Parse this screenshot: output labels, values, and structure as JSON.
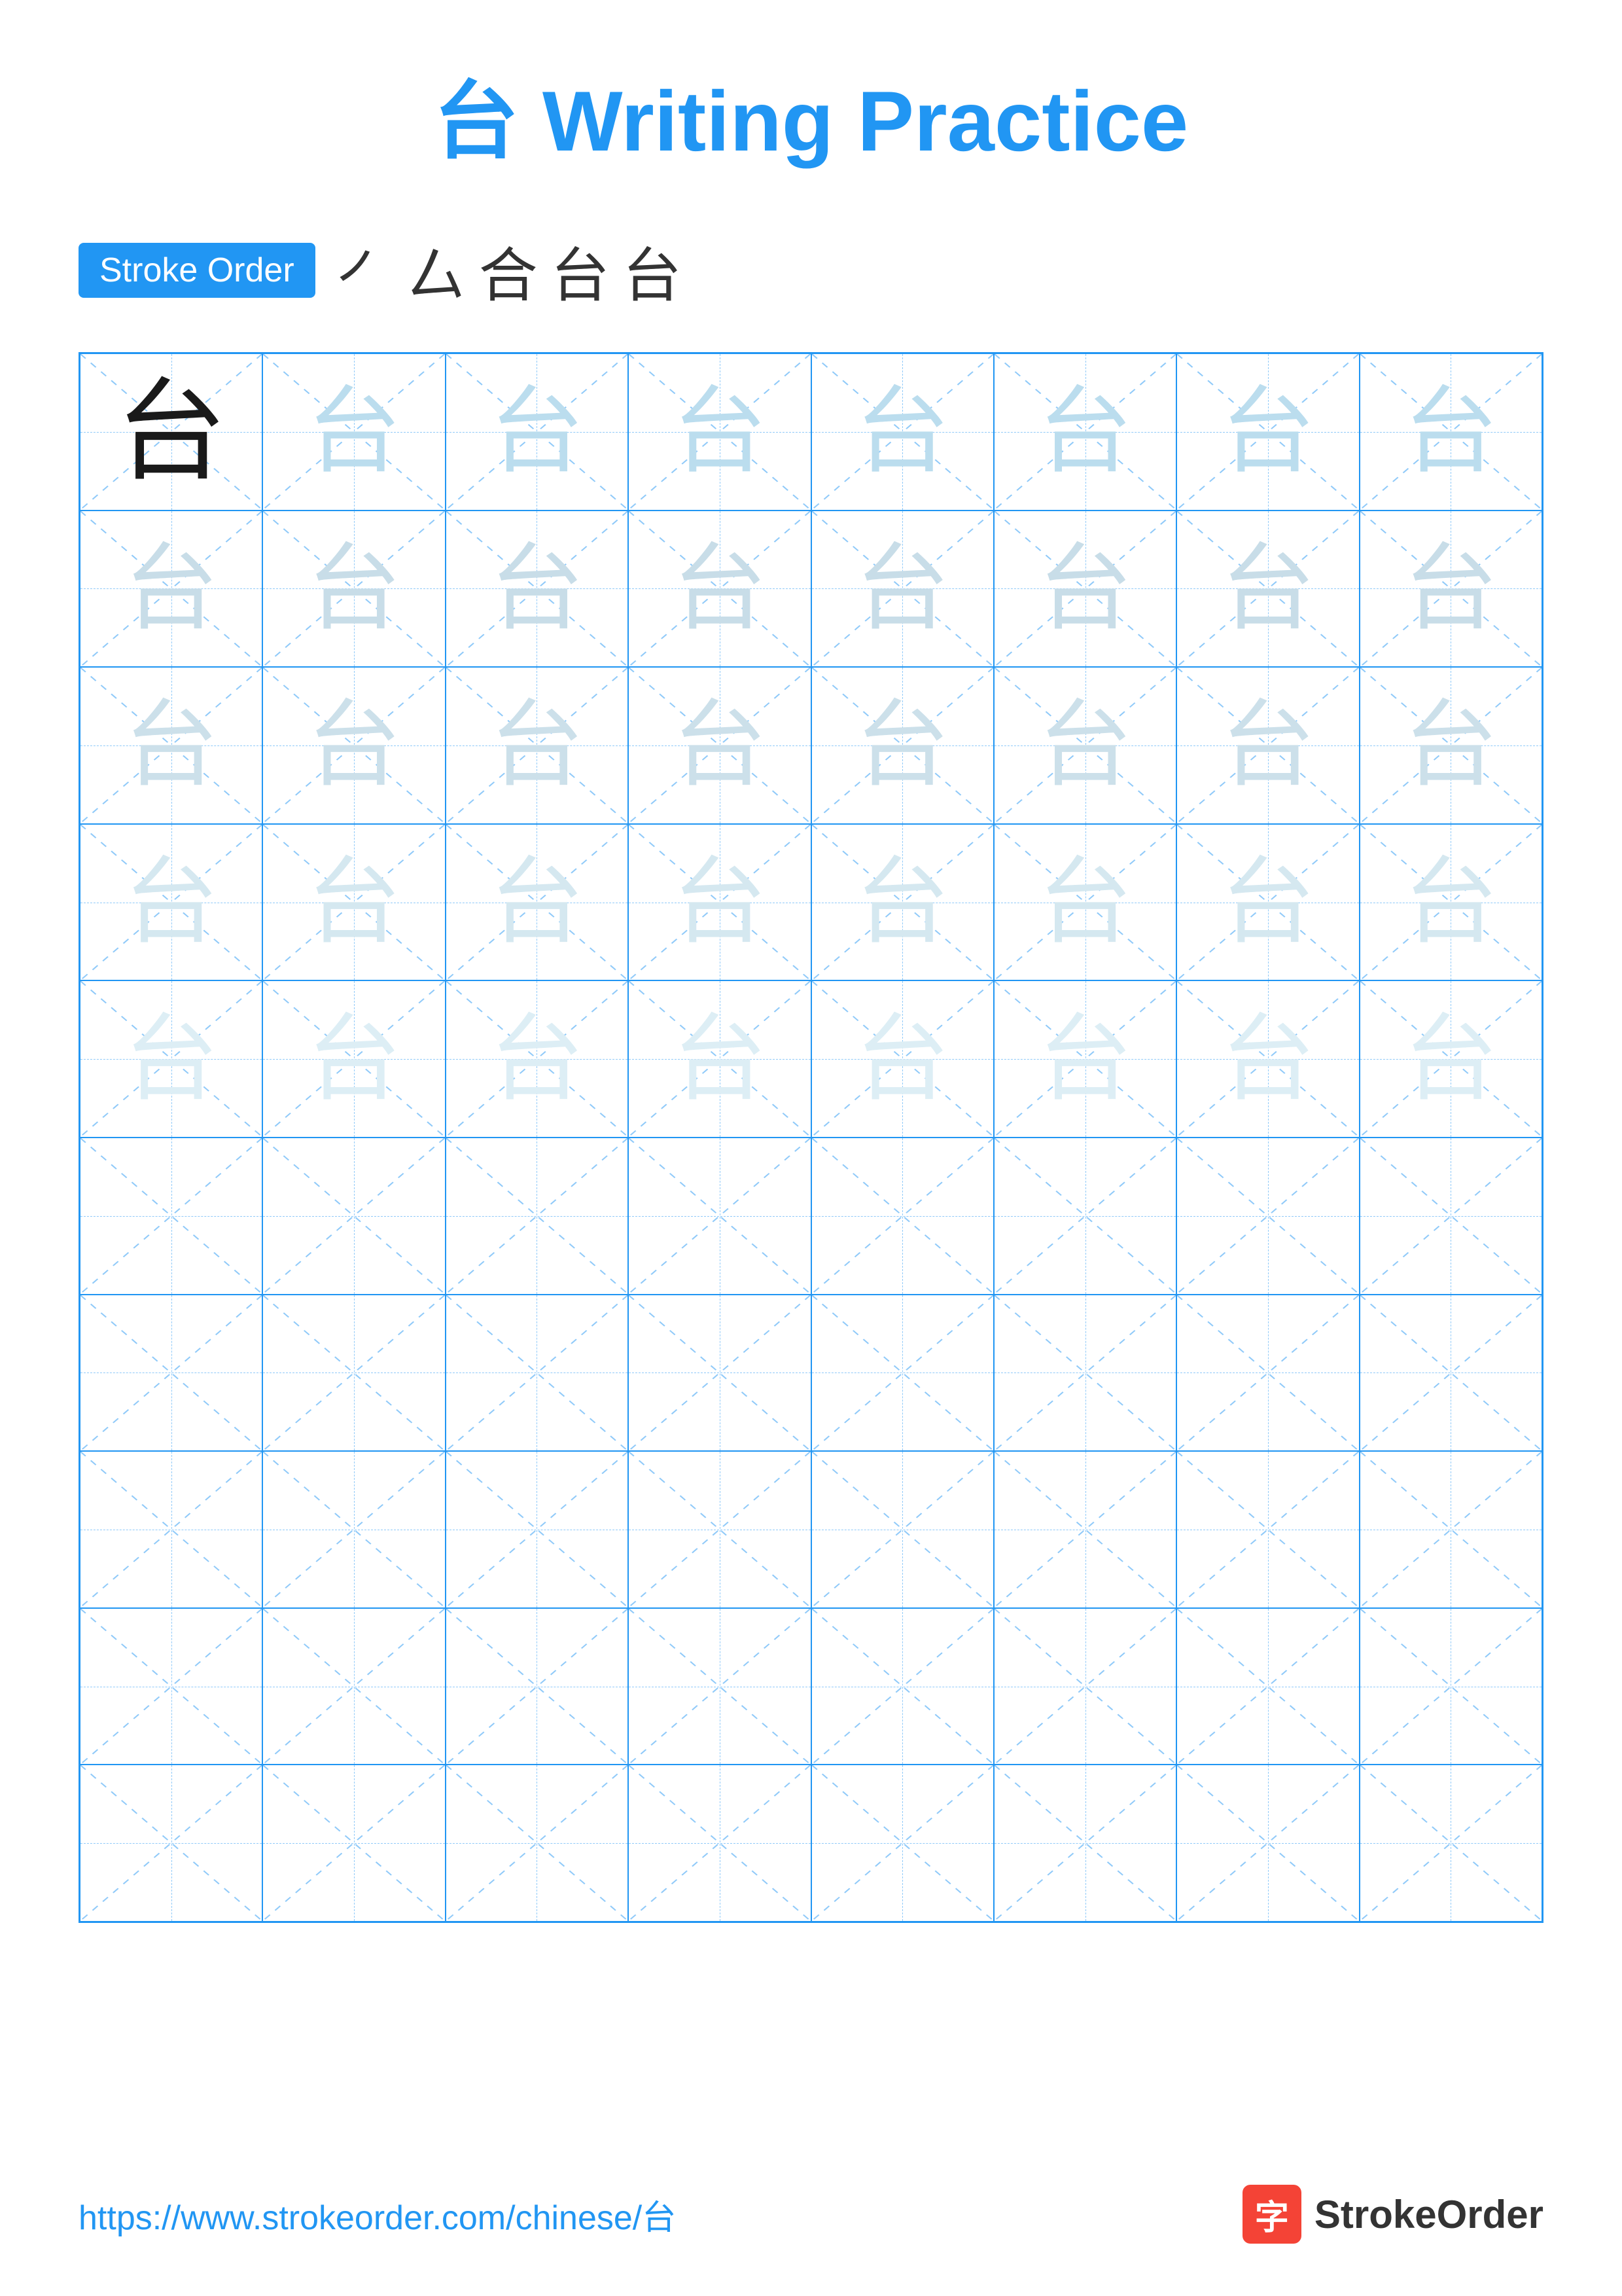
{
  "page": {
    "title": "台 Writing Practice",
    "character": "台",
    "stroke_order_label": "Stroke Order",
    "stroke_order_sequence": [
      "㇒",
      "厶",
      "合",
      "台",
      "台"
    ],
    "footer_url": "https://www.strokeorder.com/chinese/台",
    "footer_brand": "StrokeOrder",
    "grid": {
      "rows": 10,
      "cols": 8
    }
  }
}
